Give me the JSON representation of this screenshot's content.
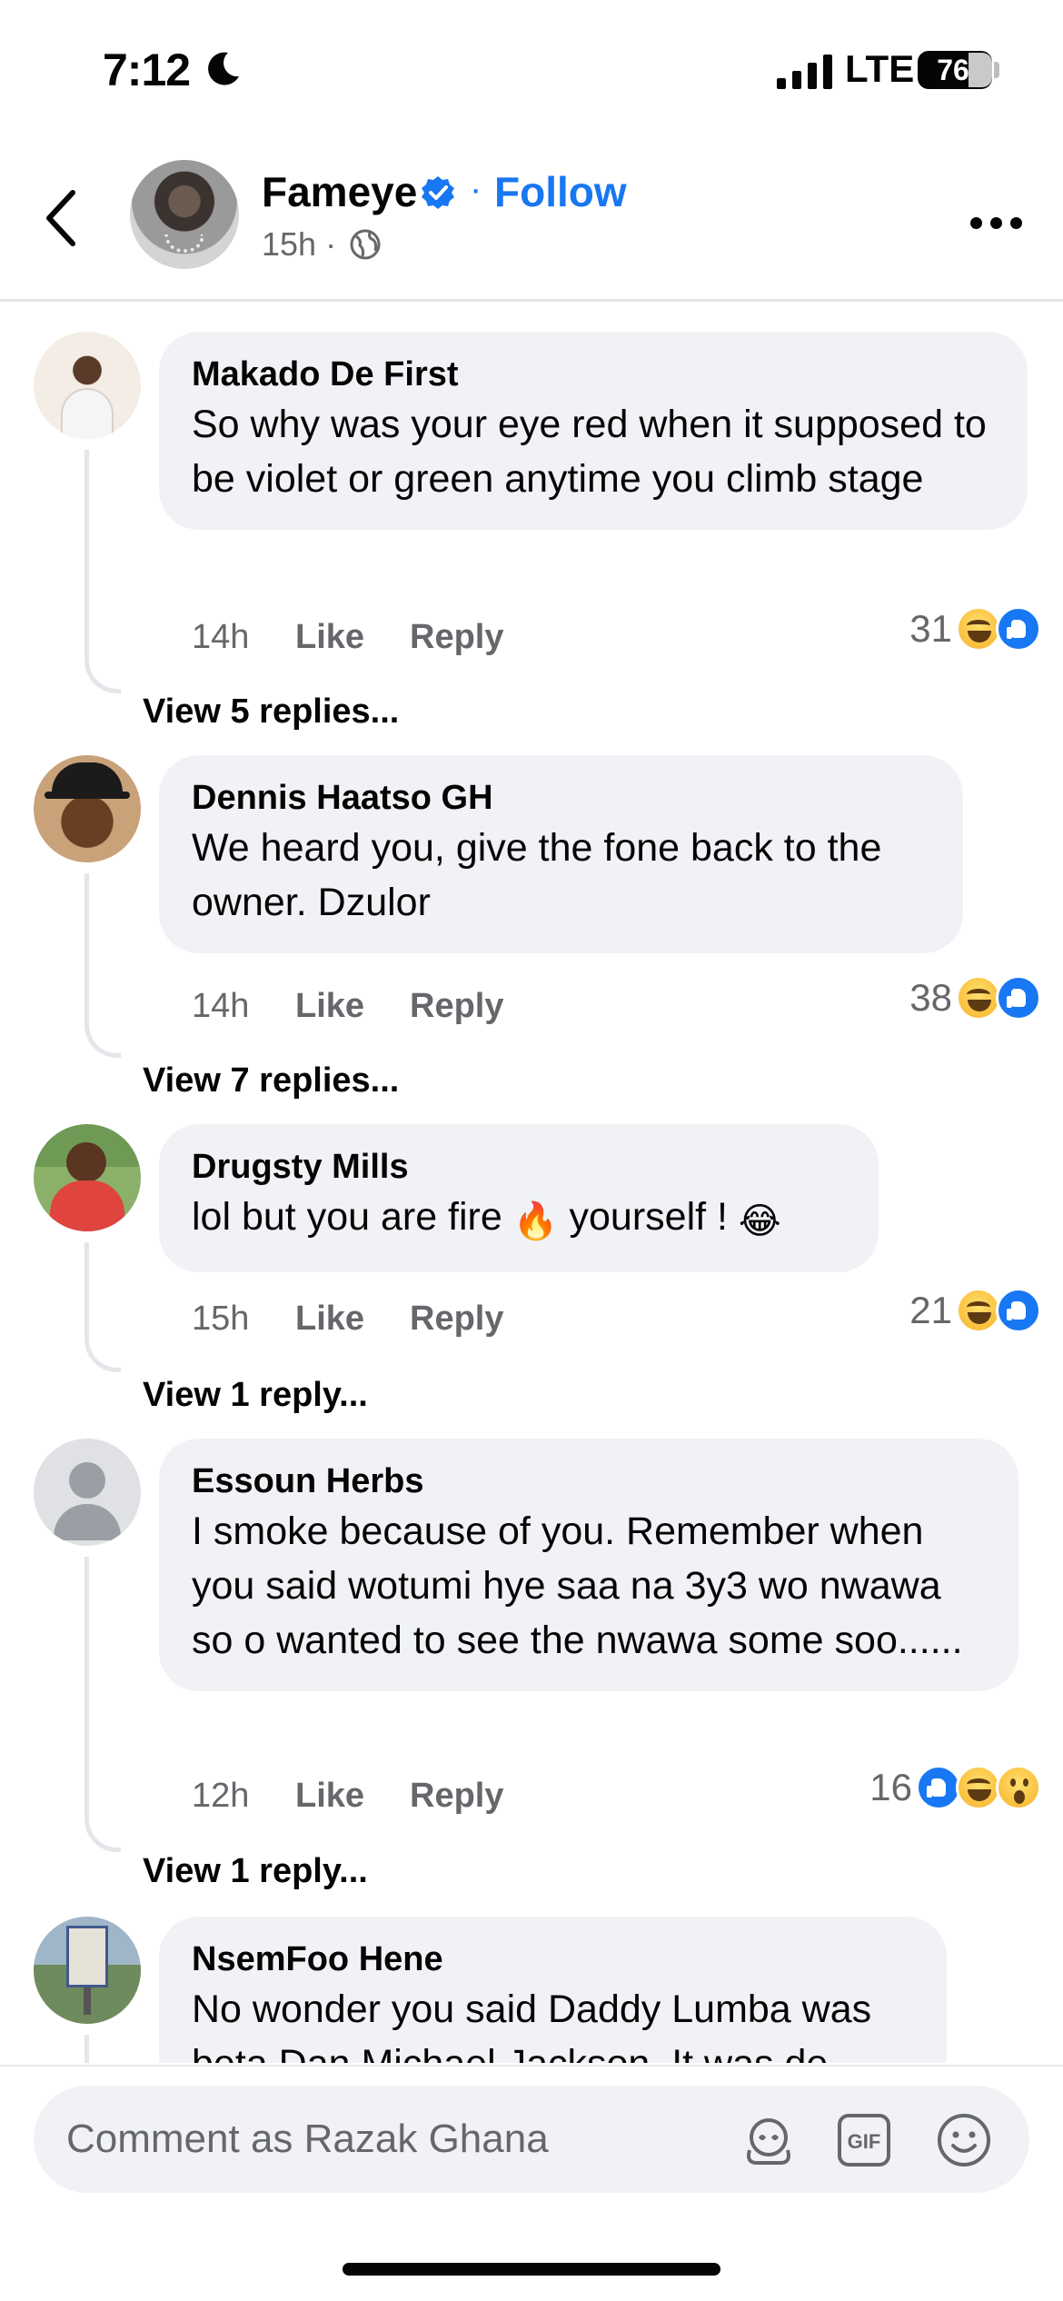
{
  "status_bar": {
    "time": "7:12",
    "network": "LTE",
    "battery": "76",
    "icons": [
      "moon-icon",
      "signal-icon",
      "battery-icon"
    ]
  },
  "header": {
    "page_name": "Fameye",
    "separator": "·",
    "follow_label": "Follow",
    "post_time": "15h ·",
    "icons": [
      "back-icon",
      "verified-badge-icon",
      "globe-icon",
      "more-icon"
    ]
  },
  "comments": [
    {
      "author": "Makado De First",
      "text": "So why was your eye red when it supposed to be violet or green anytime you climb stage",
      "time": "14h",
      "like_label": "Like",
      "reply_label": "Reply",
      "reaction_count": "31",
      "reactions": [
        "haha",
        "like"
      ],
      "view_replies": "View 5 replies..."
    },
    {
      "author": "Dennis Haatso GH",
      "text": "We heard you, give the fone back to the owner. Dzulor",
      "time": "14h",
      "like_label": "Like",
      "reply_label": "Reply",
      "reaction_count": "38",
      "reactions": [
        "haha",
        "like"
      ],
      "view_replies": "View 7 replies..."
    },
    {
      "author": "Drugsty Mills",
      "text_part1": "lol but you are fire ",
      "emoji1": "🔥",
      "text_part2": " yourself ! ",
      "emoji2": "😂",
      "time": "15h",
      "like_label": "Like",
      "reply_label": "Reply",
      "reaction_count": "21",
      "reactions": [
        "haha",
        "like"
      ],
      "view_replies": "View 1 reply..."
    },
    {
      "author": "Essoun Herbs",
      "text": "I smoke because of you. Remember when you said wotumi hye saa na 3y3 wo nwawa so o wanted to see the nwawa some soo......",
      "time": "12h",
      "like_label": "Like",
      "reply_label": "Reply",
      "reaction_count": "16",
      "reactions": [
        "like",
        "haha",
        "wow"
      ],
      "view_replies": "View 1 reply..."
    },
    {
      "author": "NsemFoo Hene",
      "text": "No wonder you said Daddy Lumba was beta Dan Michael Jackson. It was de"
    }
  ],
  "composer": {
    "placeholder": "Comment as Razak Ghana",
    "icons": [
      "avatar-sticker-icon",
      "gif-icon",
      "emoji-icon"
    ],
    "gif_label": "GIF"
  },
  "colors": {
    "accent": "#1877f2",
    "bubble": "#f0f2f5",
    "secondary_text": "#65676b"
  }
}
